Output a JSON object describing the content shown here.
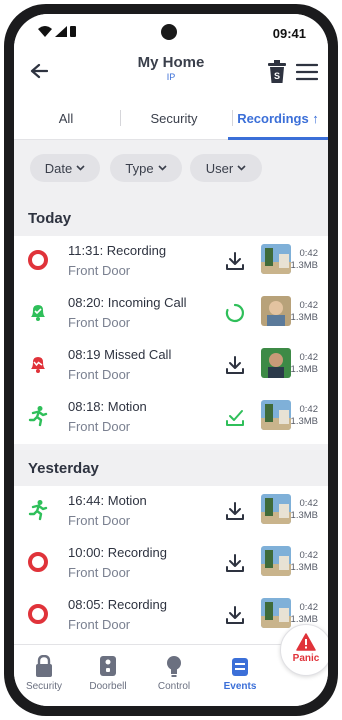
{
  "status": {
    "time": "09:41"
  },
  "header": {
    "title": "My Home",
    "subtitle": "IP"
  },
  "tabs": [
    {
      "label": "All"
    },
    {
      "label": "Security"
    },
    {
      "label": "Recordings ↑",
      "active": true
    }
  ],
  "filters": [
    {
      "label": "Date"
    },
    {
      "label": "Type"
    },
    {
      "label": "User"
    }
  ],
  "sections": {
    "today": "Today",
    "yesterday": "Yesterday"
  },
  "events_today": [
    {
      "title": "11:31: Recording",
      "location": "Front Door",
      "icon": "record-icon",
      "action": "download-icon",
      "duration": "0:42",
      "size": "1.3MB"
    },
    {
      "title": "08:20: Incoming Call",
      "location": "Front Door",
      "icon": "bell-icon",
      "action": "loading-spinner-icon",
      "duration": "0:42",
      "size": "1.3MB"
    },
    {
      "title": "08:19 Missed Call",
      "location": "Front Door",
      "icon": "missed-bell-icon",
      "action": "download-icon",
      "duration": "0:42",
      "size": "1.3MB"
    },
    {
      "title": "08:18: Motion",
      "location": "Front Door",
      "icon": "motion-icon",
      "action": "downloaded-check-icon",
      "duration": "0:42",
      "size": "1.3MB"
    }
  ],
  "events_yesterday": [
    {
      "title": "16:44: Motion",
      "location": "Front Door",
      "icon": "motion-icon",
      "action": "download-icon",
      "duration": "0:42",
      "size": "1.3MB"
    },
    {
      "title": "10:00: Recording",
      "location": "Front Door",
      "icon": "record-icon",
      "action": "download-icon",
      "duration": "0:42",
      "size": "1.3MB"
    },
    {
      "title": "08:05: Recording",
      "location": "Front Door",
      "icon": "record-icon",
      "action": "download-icon",
      "duration": "0:42",
      "size": "1.3MB"
    }
  ],
  "nav": [
    {
      "label": "Security",
      "icon": "lock-icon"
    },
    {
      "label": "Doorbell",
      "icon": "doorbell-icon"
    },
    {
      "label": "Control",
      "icon": "bulb-icon"
    },
    {
      "label": "Events",
      "icon": "events-icon",
      "active": true
    }
  ],
  "panic": {
    "label": "Panic"
  },
  "colors": {
    "accent": "#3b6fd8",
    "red": "#e0333a",
    "green": "#2fbf5a",
    "text": "#2e3340"
  }
}
